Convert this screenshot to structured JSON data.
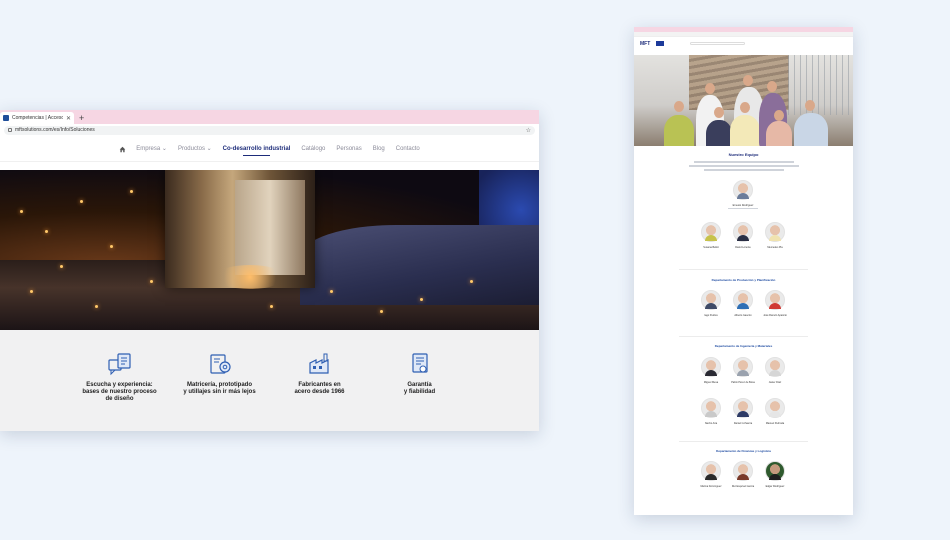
{
  "left_window": {
    "tab_title": "Competencias | Accesorios y c...",
    "url": "mftsolutions.com/es/Info/Soluciones",
    "nav": [
      {
        "label": "Empresa",
        "dropdown": true
      },
      {
        "label": "Productos",
        "dropdown": true
      },
      {
        "label": "Co-desarrollo industrial",
        "active": true
      },
      {
        "label": "Catálogo"
      },
      {
        "label": "Personas"
      },
      {
        "label": "Blog"
      },
      {
        "label": "Contacto"
      }
    ],
    "features": [
      {
        "icon": "dialogue-document-icon",
        "text": "Escucha y experiencia:\nbases de nuestro proceso\nde diseño"
      },
      {
        "icon": "tools-gear-icon",
        "text": "Matricería, prototipado\ny utillajes sin ir más lejos"
      },
      {
        "icon": "factory-icon",
        "text": "Fabricantes en\nacero desde 1966"
      },
      {
        "icon": "certificate-icon",
        "text": "Garantía\ny fiabilidad"
      }
    ],
    "colors": {
      "accent": "#1d2c7a",
      "tab_bar": "#f6d6e3",
      "icon_blue": "#2f5fb3"
    }
  },
  "right_window": {
    "logo": "MFT",
    "team_title": "Nuestro Equipo",
    "leader": {
      "name": "Ernesto Rodríguez"
    },
    "row1": [
      {
        "name": "Susana Bellot"
      },
      {
        "name": "David Lorente"
      },
      {
        "name": "Mercedes Pla"
      }
    ],
    "dept1": "Departamento de Producción y Planificación",
    "row2": [
      {
        "name": "Iago Pedrés"
      },
      {
        "name": "Alberto Gascón"
      },
      {
        "name": "José Ramón Aparicio"
      }
    ],
    "dept2": "Departamento de Ingeniería y Materiales",
    "row3": [
      {
        "name": "Miguel Mesa"
      },
      {
        "name": "Pablo Pérez de Bosa"
      },
      {
        "name": "Javier Díaz"
      }
    ],
    "row4": [
      {
        "name": "Nacho Aria"
      },
      {
        "name": "Daniel Inchaurra"
      },
      {
        "name": "Manuel Pedroda"
      }
    ],
    "dept3": "Departamento de Finanzas y Logística",
    "row5": [
      {
        "name": "Marina Domínguez"
      },
      {
        "name": "Rut Esquivel García"
      },
      {
        "name": "Edgar Rodriguez"
      }
    ]
  }
}
